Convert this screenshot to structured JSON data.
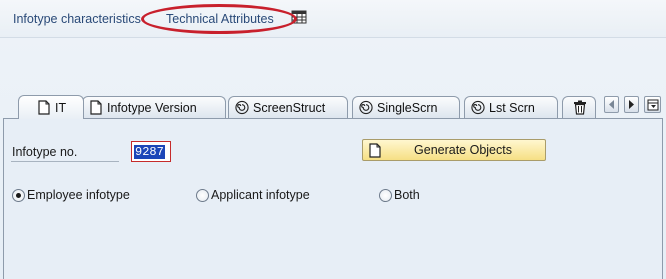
{
  "toolbar": {
    "infotype_characteristics": "Infotype characteristics",
    "technical_attributes": "Technical Attributes",
    "table_icon": "table-icon"
  },
  "tabs": [
    {
      "label": "IT",
      "icon": "document-icon",
      "active": true
    },
    {
      "label": "Infotype Version",
      "icon": "document-icon",
      "active": false
    },
    {
      "label": "ScreenStruct",
      "icon": "spiral-icon",
      "active": false
    },
    {
      "label": "SingleScrn",
      "icon": "spiral-icon",
      "active": false
    },
    {
      "label": "Lst Scrn",
      "icon": "spiral-icon",
      "active": false
    },
    {
      "label": "",
      "icon": "trash-icon",
      "active": false
    }
  ],
  "tab_nav": {
    "left_icon": "scroll-left-icon",
    "right_icon": "scroll-right-icon",
    "menu_icon": "tab-list-icon"
  },
  "form": {
    "infotype_no_label": "Infotype no.",
    "infotype_no_value": "9287",
    "generate_button_label": "Generate Objects",
    "radios": [
      {
        "label": "Employee infotype",
        "selected": true
      },
      {
        "label": "Applicant infotype",
        "selected": false
      },
      {
        "label": "Both",
        "selected": false
      }
    ]
  },
  "colors": {
    "annotation_ring": "#c8202c",
    "selection_highlight": "#1c46b8",
    "button_yellow": "#f6df84"
  }
}
